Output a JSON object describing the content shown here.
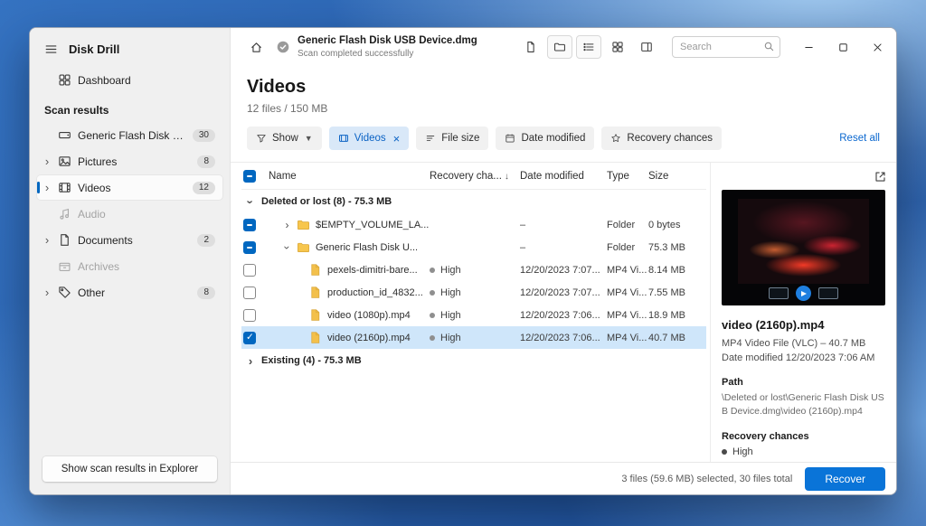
{
  "colors": {
    "accent": "#0067c0",
    "selection_row": "#cfe6fa",
    "active_chip_bg": "#d9e8f8",
    "link": "#0a67cf",
    "recover_button": "#0a74d8",
    "folder_icon": "#f7c64d"
  },
  "sidebar": {
    "title": "Disk Drill",
    "dashboard": "Dashboard",
    "section": "Scan results",
    "items": [
      {
        "label": "Generic Flash Disk USB D...",
        "badge": "30"
      },
      {
        "label": "Pictures",
        "badge": "8"
      },
      {
        "label": "Videos",
        "badge": "12"
      },
      {
        "label": "Audio"
      },
      {
        "label": "Documents",
        "badge": "2"
      },
      {
        "label": "Archives"
      },
      {
        "label": "Other",
        "badge": "8"
      }
    ],
    "footer_button": "Show scan results in Explorer"
  },
  "titlebar": {
    "title": "Generic Flash Disk USB Device.dmg",
    "subtitle": "Scan completed successfully",
    "search_placeholder": "Search"
  },
  "page": {
    "title": "Videos",
    "subtitle": "12 files / 150 MB"
  },
  "filters": {
    "show": "Show",
    "active": "Videos",
    "file_size": "File size",
    "date_modified": "Date modified",
    "recovery_chances": "Recovery chances",
    "reset": "Reset all"
  },
  "table": {
    "columns": {
      "name": "Name",
      "recovery": "Recovery cha...",
      "date": "Date modified",
      "type": "Type",
      "size": "Size"
    },
    "group_deleted": "Deleted or lost (8) - 75.3 MB",
    "group_existing": "Existing (4) - 75.3 MB",
    "rows": [
      {
        "name": "$EMPTY_VOLUME_LA...",
        "date": "–",
        "type": "Folder",
        "size": "0 bytes"
      },
      {
        "name": "Generic Flash Disk U...",
        "date": "–",
        "type": "Folder",
        "size": "75.3 MB"
      },
      {
        "name": "pexels-dimitri-bare...",
        "recovery": "High",
        "date": "12/20/2023 7:07...",
        "type": "MP4 Vi...",
        "size": "8.14 MB"
      },
      {
        "name": "production_id_4832...",
        "recovery": "High",
        "date": "12/20/2023 7:07...",
        "type": "MP4 Vi...",
        "size": "7.55 MB"
      },
      {
        "name": "video (1080p).mp4",
        "recovery": "High",
        "date": "12/20/2023 7:06...",
        "type": "MP4 Vi...",
        "size": "18.9 MB"
      },
      {
        "name": "video (2160p).mp4",
        "recovery": "High",
        "date": "12/20/2023 7:06...",
        "type": "MP4 Vi...",
        "size": "40.7 MB"
      }
    ]
  },
  "preview": {
    "file_name": "video (2160p).mp4",
    "file_info": "MP4 Video File (VLC) – 40.7 MB",
    "date_modified": "Date modified 12/20/2023 7:06 AM",
    "path_label": "Path",
    "path": "\\Deleted or lost\\Generic Flash Disk USB Device.dmg\\video (2160p).mp4",
    "recovery_label": "Recovery chances",
    "recovery_value": "High"
  },
  "statusbar": {
    "summary": "3 files (59.6 MB) selected, 30 files total",
    "recover": "Recover"
  }
}
